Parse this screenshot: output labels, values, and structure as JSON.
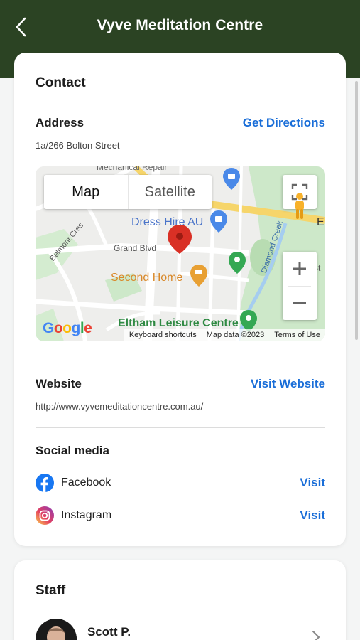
{
  "header": {
    "title": "Vyve Meditation Centre"
  },
  "contact": {
    "title": "Contact",
    "address": {
      "label": "Address",
      "value": "1a/266 Bolton Street",
      "action": "Get Directions"
    },
    "map": {
      "toggle_map": "Map",
      "toggle_satellite": "Satellite",
      "labels": {
        "dress_hire": "Dress Hire AU",
        "second_home": "Second Home",
        "eltham_leisure": "Eltham Leisure Centre",
        "grand_blvd": "Grand Blvd",
        "belmont_cres": "Belmont Cres",
        "diamond_creek": "Diamond Creek",
        "mechanical_repair": "Mechanical Repair",
        "st": "St",
        "e": "E"
      },
      "google": [
        "G",
        "o",
        "o",
        "g",
        "l",
        "e"
      ],
      "footer": {
        "shortcuts": "Keyboard shortcuts",
        "data": "Map data ©2023",
        "terms": "Terms of Use"
      }
    },
    "website": {
      "label": "Website",
      "value": "http://www.vyvemeditationcentre.com.au/",
      "action": "Visit Website"
    },
    "social": {
      "label": "Social media",
      "items": [
        {
          "name": "Facebook",
          "action": "Visit",
          "icon": "facebook-icon"
        },
        {
          "name": "Instagram",
          "action": "Visit",
          "icon": "instagram-icon"
        }
      ]
    }
  },
  "staff": {
    "title": "Staff",
    "members": [
      {
        "name": "Scott P."
      }
    ]
  },
  "colors": {
    "header_bg": "#2b4323",
    "link": "#1a6ed8",
    "pin_red": "#d93025",
    "pin_green": "#34a853",
    "pin_orange": "#e8a033",
    "pin_blue": "#4a89e8"
  }
}
